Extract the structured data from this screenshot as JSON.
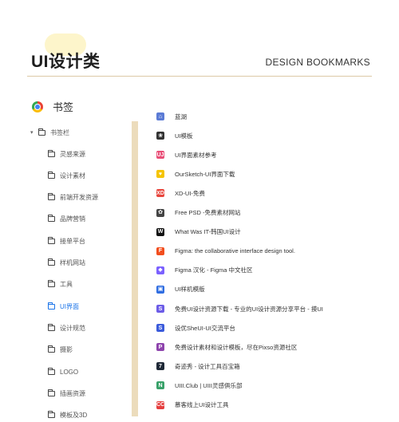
{
  "header": {
    "brand": "UI设计类",
    "tagline": "DESIGN BOOKMARKS"
  },
  "bookmarks_header": {
    "icon": "chrome-icon",
    "title": "书签"
  },
  "tree": {
    "root": {
      "label": "书签栏",
      "expanded": true
    },
    "items": [
      {
        "label": "灵感来源"
      },
      {
        "label": "设计素材"
      },
      {
        "label": "前端开发资源"
      },
      {
        "label": "品牌营销"
      },
      {
        "label": "接单平台"
      },
      {
        "label": "样机网站"
      },
      {
        "label": "工具"
      },
      {
        "label": "UI界面",
        "active": true
      },
      {
        "label": "设计规范"
      },
      {
        "label": "摄影"
      },
      {
        "label": "LOGO"
      },
      {
        "label": "插画资源"
      },
      {
        "label": "模板及3D"
      }
    ]
  },
  "bookmarks": [
    {
      "icon": "blue-logo-icon",
      "color": "#5b7bd5",
      "glyph": "⌂",
      "label": "蓝湖"
    },
    {
      "icon": "pattern-icon",
      "color": "#333333",
      "glyph": "❀",
      "label": "UI模板"
    },
    {
      "icon": "uj-icon",
      "color": "#e94e77",
      "glyph": "UJ",
      "label": "UI界面素材参考"
    },
    {
      "icon": "heart-icon",
      "color": "#f5c400",
      "glyph": "♥",
      "label": "OurSketch-UI界面下载"
    },
    {
      "icon": "xd-icon",
      "color": "#e8453c",
      "glyph": "XD",
      "label": "XD-UI-免费"
    },
    {
      "icon": "freepsd-icon",
      "color": "#444444",
      "glyph": "✿",
      "label": "Free PSD -免费素材网站"
    },
    {
      "icon": "w-icon",
      "color": "#111111",
      "glyph": "W",
      "label": "What Was IT-韩国UI设计"
    },
    {
      "icon": "figma-icon",
      "color": "#f24e1e",
      "glyph": "F",
      "label": "Figma: the collaborative interface design tool."
    },
    {
      "icon": "figma-cn-icon",
      "color": "#7b61ff",
      "glyph": "◆",
      "label": "Figma 汉化 - Figma 中文社区"
    },
    {
      "icon": "mockup-icon",
      "color": "#2f6de1",
      "glyph": "▣",
      "label": "UI样机模版"
    },
    {
      "icon": "s-icon",
      "color": "#6c5ce7",
      "glyph": "S",
      "label": "免费UI设计资源下载 - 专业的UI设计资源分享平台 - 摸UI"
    },
    {
      "icon": "sheui-icon",
      "color": "#3b5bdb",
      "glyph": "S",
      "label": "设优SheUI-UI交流平台"
    },
    {
      "icon": "pixso-icon",
      "color": "#8e44ad",
      "glyph": "P",
      "label": "免费设计素材和设计模板，尽在Pixso资源社区"
    },
    {
      "icon": "seven-icon",
      "color": "#1f2937",
      "glyph": "7",
      "label": "奇迹秀 - 设计工具百宝箱"
    },
    {
      "icon": "uiii-icon",
      "color": "#38a169",
      "glyph": "N",
      "label": "UIII.Club | UIII灵感俱乐部"
    },
    {
      "icon": "cc-icon",
      "color": "#e53e3e",
      "glyph": "CC",
      "label": "慕客线上UI设计工具"
    }
  ]
}
